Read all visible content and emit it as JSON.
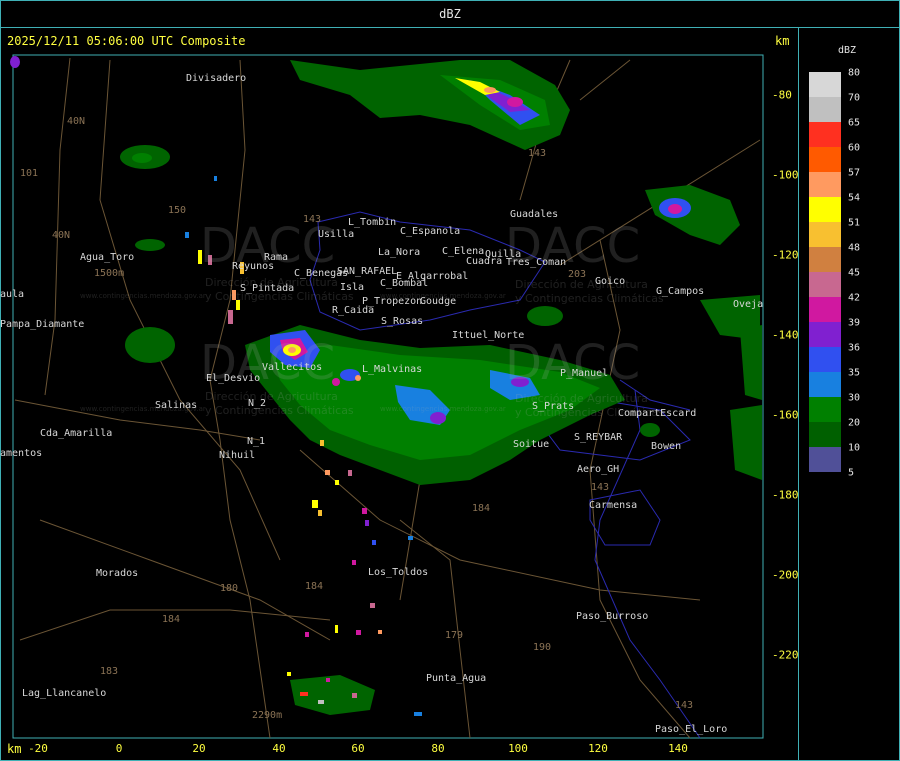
{
  "header": {
    "title": "dBZ"
  },
  "map": {
    "timestamp": "2025/12/11 05:06:00 UTC Composite",
    "unit_top": "km",
    "unit_bottom": "km",
    "x_ticks": [
      "-20",
      "0",
      "20",
      "40",
      "60",
      "80",
      "100",
      "120",
      "140"
    ],
    "y_ticks": [
      "-80",
      "-100",
      "-120",
      "-140",
      "-160",
      "-180",
      "-200",
      "-220"
    ],
    "places": [
      {
        "name": "Divisadero"
      },
      {
        "name": "Agua_Toro"
      },
      {
        "name": "Pampa_Diamante"
      },
      {
        "name": "aula"
      },
      {
        "name": "Cda_Amarilla"
      },
      {
        "name": "amentos"
      },
      {
        "name": "Morados"
      },
      {
        "name": "Lag_Llancanelo"
      },
      {
        "name": "Salinas"
      },
      {
        "name": "El_Desvio"
      },
      {
        "name": "N_2"
      },
      {
        "name": "N_1"
      },
      {
        "name": "Nihuil"
      },
      {
        "name": "S_Pintada"
      },
      {
        "name": "Rama"
      },
      {
        "name": "Reyunos"
      },
      {
        "name": "Usilla"
      },
      {
        "name": "L_Tombin"
      },
      {
        "name": "C_Espanola"
      },
      {
        "name": "La_Nora"
      },
      {
        "name": "C_Benegas"
      },
      {
        "name": "SAN_RAFAEL"
      },
      {
        "name": "E_Algarrobal"
      },
      {
        "name": "C_Bombal"
      },
      {
        "name": "Isla"
      },
      {
        "name": "P_Tropezon"
      },
      {
        "name": "Goudge"
      },
      {
        "name": "R_Caida"
      },
      {
        "name": "S_Rosas"
      },
      {
        "name": "Ittuel_Norte"
      },
      {
        "name": "L_Malvinas"
      },
      {
        "name": "C_Elena"
      },
      {
        "name": "Cuadra"
      },
      {
        "name": "Quilla"
      },
      {
        "name": "Tres_Coman"
      },
      {
        "name": "Guadales"
      },
      {
        "name": "Goico"
      },
      {
        "name": "G_Campos"
      },
      {
        "name": "Oveja"
      },
      {
        "name": "S_Prats"
      },
      {
        "name": "CompartEscard"
      },
      {
        "name": "S_REYBAR"
      },
      {
        "name": "Bowen"
      },
      {
        "name": "Soitue"
      },
      {
        "name": "Aero_GH"
      },
      {
        "name": "Carmensa"
      },
      {
        "name": "Los_Toldos"
      },
      {
        "name": "Paso_Burroso"
      },
      {
        "name": "Punta_Agua"
      },
      {
        "name": "Paso_El_Loro"
      },
      {
        "name": "Vallecitos"
      },
      {
        "name": "P_Manuel"
      }
    ],
    "routes": [
      "40N",
      "101",
      "40N",
      "150",
      "143",
      "143",
      "143",
      "203",
      "184",
      "184",
      "184",
      "180",
      "183",
      "179",
      "190",
      "143",
      "2290m",
      "1500m"
    ],
    "watermark": {
      "logo_text": "DACC",
      "line1": "Dirección de Agricultura",
      "line2": "y Contingencias Climáticas",
      "url": "www.contingencias.mendoza.gov.ar"
    }
  },
  "legend": {
    "title": "dBZ",
    "levels": [
      {
        "label": "80",
        "color": "#d7d7d7"
      },
      {
        "label": "70",
        "color": "#c0c0c0"
      },
      {
        "label": "65",
        "color": "#ff3020"
      },
      {
        "label": "60",
        "color": "#ff5a00"
      },
      {
        "label": "57",
        "color": "#ff9a60"
      },
      {
        "label": "54",
        "color": "#ffff00"
      },
      {
        "label": "51",
        "color": "#f8c030"
      },
      {
        "label": "48",
        "color": "#d08040"
      },
      {
        "label": "45",
        "color": "#c86890"
      },
      {
        "label": "42",
        "color": "#d018a0"
      },
      {
        "label": "39",
        "color": "#8020d0"
      },
      {
        "label": "36",
        "color": "#3050f0"
      },
      {
        "label": "35",
        "color": "#1880e0"
      },
      {
        "label": "30",
        "color": "#008000"
      },
      {
        "label": "20",
        "color": "#006000"
      },
      {
        "label": "10",
        "color": "#505098"
      },
      {
        "label": "5",
        "color": ""
      }
    ]
  }
}
